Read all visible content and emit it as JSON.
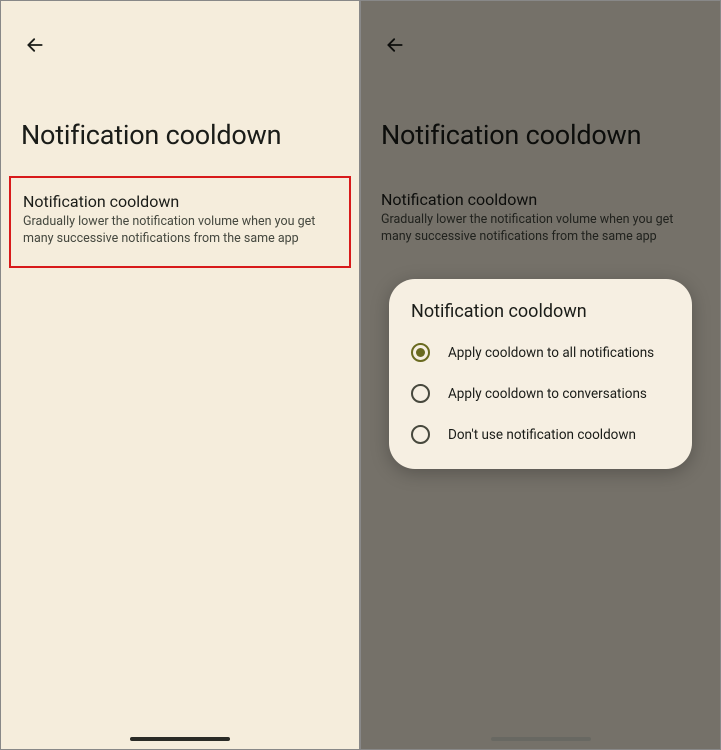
{
  "leftPanel": {
    "pageTitle": "Notification cooldown",
    "setting": {
      "title": "Notification cooldown",
      "description": "Gradually lower the notification volume when you get many successive notifications from the same app"
    }
  },
  "rightPanel": {
    "pageTitle": "Notification cooldown",
    "setting": {
      "title": "Notification cooldown",
      "description": "Gradually lower the notification volume when you get many successive notifications from the same app"
    },
    "dialog": {
      "title": "Notification cooldown",
      "options": [
        {
          "label": "Apply cooldown to all notifications",
          "selected": true
        },
        {
          "label": "Apply cooldown to conversations",
          "selected": false
        },
        {
          "label": "Don't use notification cooldown",
          "selected": false
        }
      ]
    }
  }
}
